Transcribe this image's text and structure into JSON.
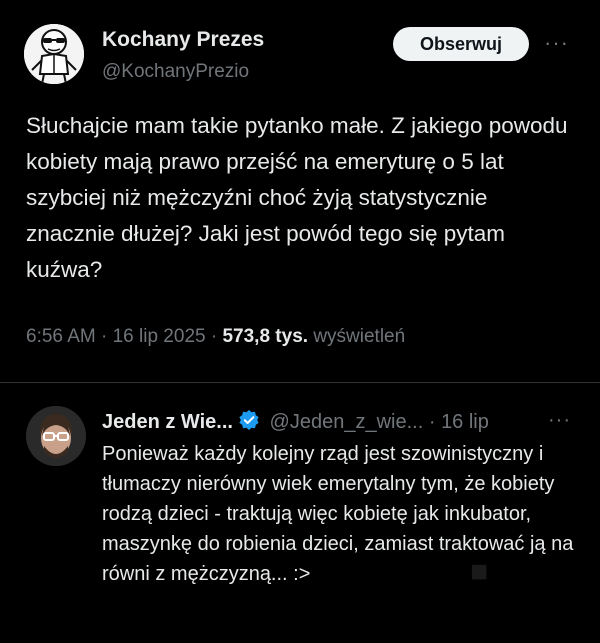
{
  "post": {
    "author_name": "Kochany Prezes",
    "author_handle": "@KochanyPrezio",
    "follow_label": "Obserwuj",
    "more_label": "···",
    "text": "Słuchajcie mam takie pytanko małe. Z jakiego powodu kobiety mają prawo przejść na emeryturę o 5 lat szybciej niż mężczyźni choć żyją statystycznie znacznie dłużej? Jaki jest powód tego się pytam kuźwa?",
    "time": "6:56 AM",
    "date": "16 lip 2025",
    "views_count": "573,8 tys.",
    "views_label": "wyświetleń",
    "separator": "·"
  },
  "reply": {
    "author_name": "Jeden z Wie...",
    "author_handle": "@Jeden_z_wie...",
    "date": "16 lip",
    "separator": "·",
    "more_label": "···",
    "text": "Ponieważ każdy kolejny rząd jest szowinistyczny i tłumaczy nierówny wiek emerytalny tym, że kobiety rodzą dzieci - traktują więc kobietę jak inkubator, maszynkę do robienia dzieci, zamiast traktować ją na równi z mężczyzną... :>",
    "verified_icon": "verified-badge-icon"
  },
  "colors": {
    "background": "#000000",
    "text": "#e7e9ea",
    "secondary": "#71767b",
    "verified": "#1d9bf0",
    "button_bg": "#eff3f4"
  }
}
